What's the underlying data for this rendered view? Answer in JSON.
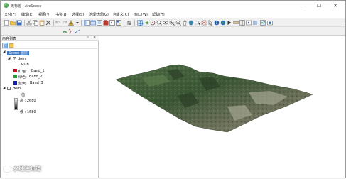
{
  "window": {
    "title": "无标题 - ArcScene"
  },
  "titlebar": {
    "minimize": "—",
    "maximize": "☐",
    "close": "✕"
  },
  "menu": [
    "文件(F)",
    "编辑(E)",
    "视图(V)",
    "书签(B)",
    "选择(S)",
    "地理处理(G)",
    "自定义(C)",
    "窗口(W)",
    "帮助(H)"
  ],
  "layer_dropdown": {
    "value": "dem"
  },
  "toc": {
    "title": "内容列表",
    "pin": "♮",
    "close": "✕",
    "scene_label": "Scene 图层",
    "layers": [
      {
        "name": "dom",
        "checked": true,
        "renderer": "RGB",
        "bands": [
          {
            "channel": "红色:",
            "band": "Band_1",
            "color": "#e0001b"
          },
          {
            "channel": "绿色:",
            "band": "Band_2",
            "color": "#1aa12b"
          },
          {
            "channel": "蓝色:",
            "band": "Band_3",
            "color": "#1020c8"
          }
        ]
      },
      {
        "name": "dem",
        "checked": false,
        "value_label": "值",
        "high": "高 : 2680",
        "low": "低 : 1680"
      }
    ]
  },
  "watermark": {
    "text": "水经注知道"
  },
  "colors": {
    "selection": "#3a78c3",
    "terrain_dark": "#3d5a34",
    "terrain_light": "#8a8f7a"
  }
}
